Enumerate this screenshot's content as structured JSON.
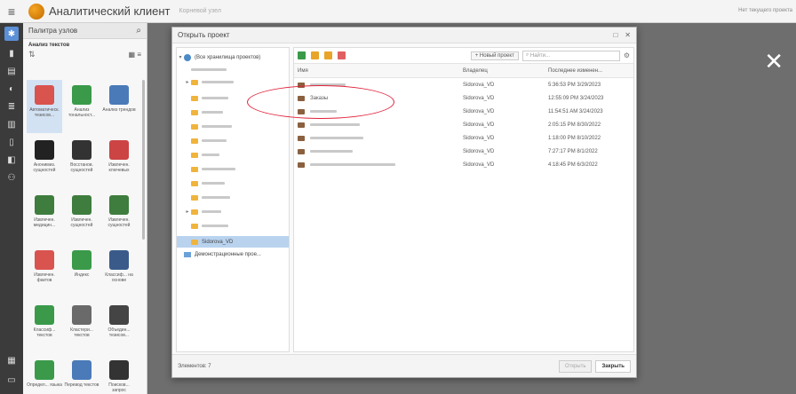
{
  "app": {
    "title": "Аналитический клиент",
    "subtitle": "Корневой узел",
    "status": "Нет текущего проекта"
  },
  "palette": {
    "title": "Палитра узлов",
    "section": "Анализ текстов",
    "items": [
      {
        "label": "Автоматическ. тезисов..."
      },
      {
        "label": "Анализ тональност..."
      },
      {
        "label": "Анализ трендов"
      },
      {
        "label": "Анонимиз. сущностей"
      },
      {
        "label": "Восстанов. сущностей"
      },
      {
        "label": "Извлечен. ключевых"
      },
      {
        "label": "Извлечен. медицин..."
      },
      {
        "label": "Извлечен. сущностей"
      },
      {
        "label": "Извлечен. сущностей"
      },
      {
        "label": "Извлечен. фактов"
      },
      {
        "label": "Индекс"
      },
      {
        "label": "Классиф... на основе"
      },
      {
        "label": "Классиф... текстов"
      },
      {
        "label": "Кластери... текстов"
      },
      {
        "label": "Объедин... тезисов..."
      },
      {
        "label": "Определ... языка"
      },
      {
        "label": "Перевод текстов"
      },
      {
        "label": "Поисков... запрос"
      }
    ]
  },
  "dialog": {
    "title": "Открыть проект",
    "tree_root": "(Все хранилища проектов)",
    "tree_selected": "Sidorova_VD",
    "tree_demo": "Демонстрационные прое...",
    "new_project": "+ Новый проект",
    "search_placeholder": "Найти...",
    "columns": {
      "name": "Имя",
      "owner": "Владелец",
      "date": "Последнее изменен..."
    },
    "rows": [
      {
        "name": "",
        "owner": "Sidorova_VD",
        "date": "5:36:53 PM 3/29/2023"
      },
      {
        "name": "Заказы",
        "owner": "Sidorova_VD",
        "date": "12:55:09 PM 3/24/2023"
      },
      {
        "name": "",
        "owner": "Sidorova_VD",
        "date": "11:54:51 AM 3/24/2023"
      },
      {
        "name": "",
        "owner": "Sidorova_VD",
        "date": "2:05:15 PM 8/30/2022"
      },
      {
        "name": "",
        "owner": "Sidorova_VD",
        "date": "1:18:00 PM 8/10/2022"
      },
      {
        "name": "",
        "owner": "Sidorova_VD",
        "date": "7:27:17 PM 8/1/2022"
      },
      {
        "name": "",
        "owner": "Sidorova_VD",
        "date": "4:18:45 PM 6/3/2022"
      }
    ],
    "items_count": "Элементов: 7",
    "open_button": "Открыть",
    "close_button": "Закрыть"
  },
  "icons": {
    "hamburger": "menu-icon",
    "overlay_close": "close-icon",
    "search": "search-icon",
    "settings": "gear-icon"
  },
  "colors": {
    "accent": "#5b8fd6",
    "annotation": "#e0213a",
    "selection": "#b9d3ef"
  }
}
